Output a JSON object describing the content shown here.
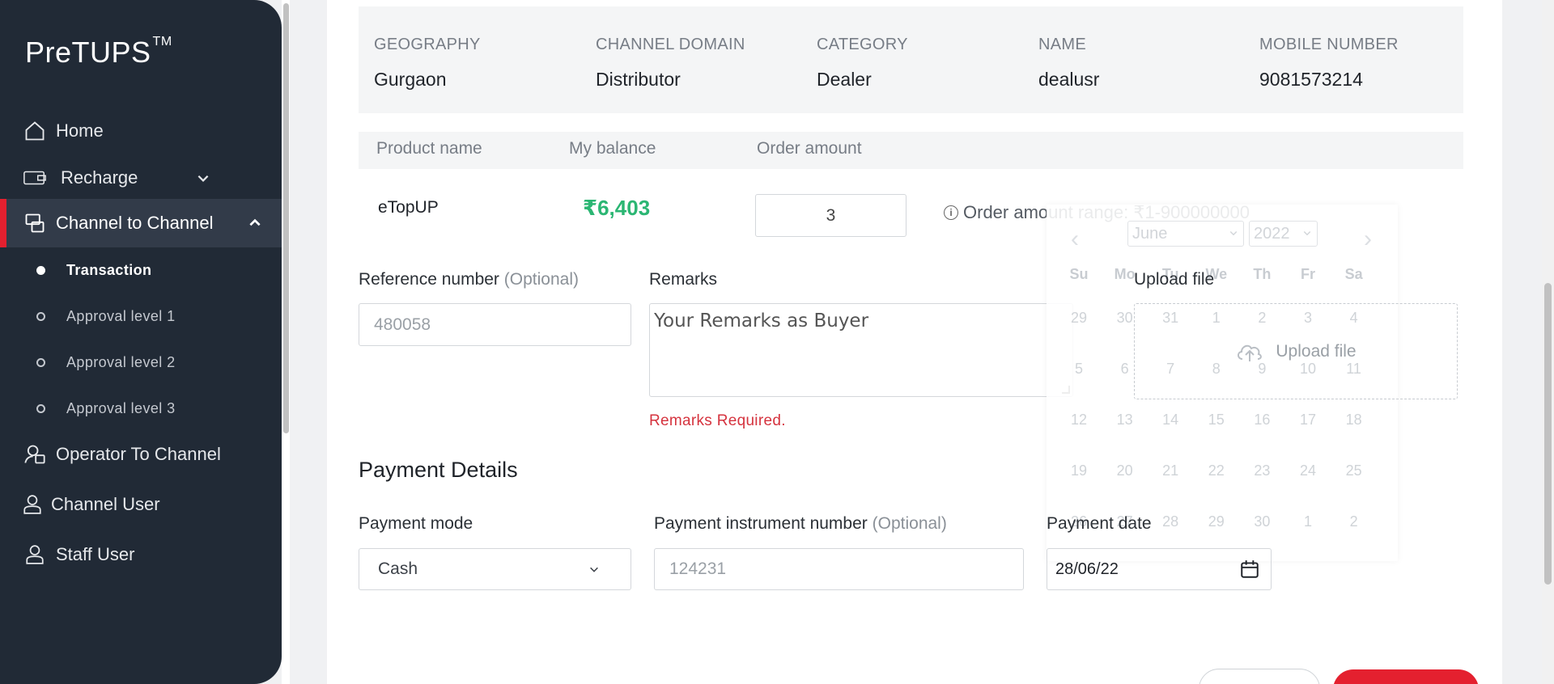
{
  "sidebar": {
    "logo": "PreTUPS",
    "logo_tm": "TM",
    "items": [
      {
        "label": "Home",
        "icon": "home-icon"
      },
      {
        "label": "Recharge",
        "icon": "recharge-icon"
      },
      {
        "label": "Channel to Channel",
        "icon": "channel-icon"
      },
      {
        "label": "Operator To Channel",
        "icon": "operator-icon"
      },
      {
        "label": "Channel User",
        "icon": "user-icon"
      },
      {
        "label": "Staff User",
        "icon": "user-icon"
      }
    ],
    "sub_items": [
      {
        "label": "Transaction"
      },
      {
        "label": "Approval level 1"
      },
      {
        "label": "Approval level 2"
      },
      {
        "label": "Approval level 3"
      }
    ]
  },
  "info": {
    "geography_label": "GEOGRAPHY",
    "geography_value": "Gurgaon",
    "domain_label": "CHANNEL DOMAIN",
    "domain_value": "Distributor",
    "category_label": "CATEGORY",
    "category_value": "Dealer",
    "name_label": "NAME",
    "name_value": "dealusr",
    "mobile_label": "MOBILE NUMBER",
    "mobile_value": "9081573214"
  },
  "product": {
    "col_name": "Product name",
    "col_balance": "My balance",
    "col_order": "Order amount",
    "name": "eTopUP",
    "balance": "₹6,403",
    "order_amount": "3",
    "range_note": "Order amount range: ₹1-900000000"
  },
  "form": {
    "reference_label": "Reference number",
    "optional": "(Optional)",
    "reference_placeholder": "480058",
    "remarks_label": "Remarks",
    "remarks_value": "Your Remarks as Buyer",
    "remarks_error": "Remarks Required.",
    "upload_label": "Upload file",
    "upload_text": "Upload file"
  },
  "payment": {
    "title": "Payment Details",
    "mode_label": "Payment mode",
    "mode_value": "Cash",
    "instrument_label": "Payment instrument number",
    "instrument_placeholder": "124231",
    "date_label": "Payment date",
    "date_value": "28/06/22"
  },
  "calendar": {
    "month": "June",
    "year": "2022",
    "weekdays": [
      "Su",
      "Mo",
      "Tu",
      "We",
      "Th",
      "Fr",
      "Sa"
    ],
    "weeks": [
      [
        "29",
        "30",
        "31",
        "1",
        "2",
        "3",
        "4"
      ],
      [
        "5",
        "6",
        "7",
        "8",
        "9",
        "10",
        "11"
      ],
      [
        "12",
        "13",
        "14",
        "15",
        "16",
        "17",
        "18"
      ],
      [
        "19",
        "20",
        "21",
        "22",
        "23",
        "24",
        "25"
      ],
      [
        "26",
        "27",
        "28",
        "29",
        "30",
        "1",
        "2"
      ]
    ]
  },
  "colors": {
    "sidebar_bg": "#212a36",
    "accent_red": "#e4202f",
    "balance_green": "#2bb673",
    "error_red": "#d5333e"
  }
}
